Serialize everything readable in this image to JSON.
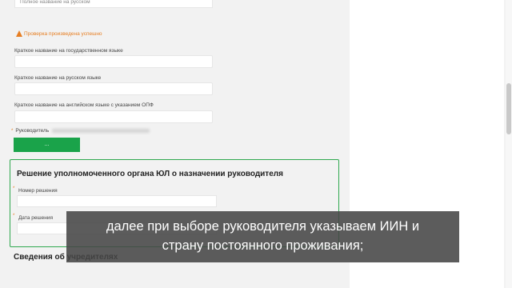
{
  "form": {
    "top_field_text": "Полное название на русском",
    "success_message": "Проверка произведена успешно",
    "short_name_state_label": "Краткое название на государственном языке",
    "short_name_ru_label": "Краткое название на русском языке",
    "short_name_en_label": "Краткое название на английском языке с указанием ОПФ",
    "head_label": "Руководитель",
    "head_button_label": "...",
    "decision": {
      "title": "Решение уполномоченного органа ЮЛ о назначении руководителя",
      "number_label": "Номер решения",
      "date_label": "Дата решения"
    },
    "founders_title": "Сведения об учредителях"
  },
  "subtitles": {
    "line1": "далее при выборе руководителя указываем ИИН и",
    "line2": "страну постоянного проживания;"
  },
  "colors": {
    "accent_green": "#1aa34a",
    "box_border": "#2fa84f",
    "success_orange": "#e67e22"
  }
}
